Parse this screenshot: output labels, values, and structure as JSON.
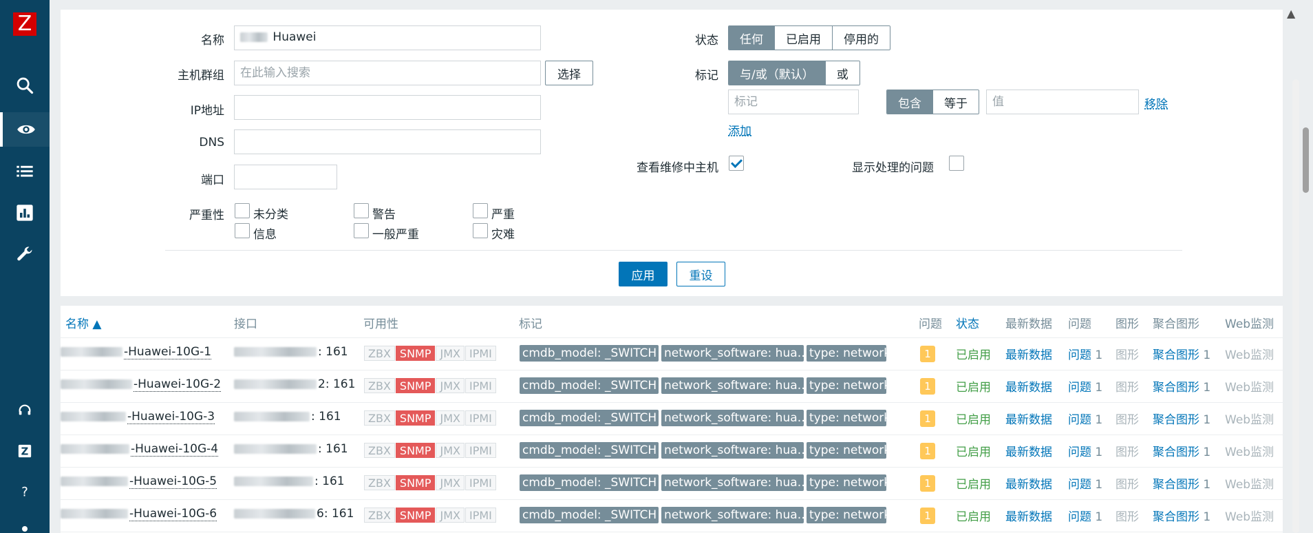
{
  "sidebar": {
    "logo": "Z",
    "icons": [
      "search-icon",
      "eye-icon",
      "list-icon",
      "chart-icon",
      "wrench-icon",
      "headset-icon",
      "zabbix-share-icon",
      "help-icon"
    ]
  },
  "filter": {
    "name_label": "名称",
    "name_value": "Huawei",
    "hostgroup_label": "主机群组",
    "hostgroup_placeholder": "在此输入搜索",
    "select_button": "选择",
    "ip_label": "IP地址",
    "dns_label": "DNS",
    "port_label": "端口",
    "severity_label": "严重性",
    "severities": [
      "未分类",
      "警告",
      "严重",
      "信息",
      "一般严重",
      "灾难"
    ],
    "status_label": "状态",
    "status_options": [
      "任何",
      "已启用",
      "停用的"
    ],
    "status_selected": "任何",
    "tags_label": "标记",
    "tag_mode_options": [
      "与/或（默认）",
      "或"
    ],
    "tag_placeholder": "标记",
    "tag_operator_options": [
      "包含",
      "等于"
    ],
    "value_placeholder": "值",
    "remove_link": "移除",
    "add_link": "添加",
    "maintenance_label": "查看维修中主机",
    "maintenance_checked": true,
    "suppressed_label": "显示处理的问题",
    "suppressed_checked": false,
    "apply_button": "应用",
    "reset_button": "重设"
  },
  "table": {
    "headers": {
      "name": "名称 ▲",
      "interface": "接口",
      "availability": "可用性",
      "tags": "标记",
      "problems": "问题",
      "status": "状态",
      "latest_data": "最新数据",
      "problems2": "问题",
      "graphs": "图形",
      "dashboards": "聚合图形",
      "web": "Web监测"
    },
    "rows": [
      {
        "name": "-Huawei-10G-1",
        "interface": ": 161",
        "problem_count": "1",
        "status": "已启用",
        "latest": "最新数据",
        "problems": "问题",
        "problems_n": "1",
        "graphs": "图形",
        "dashboards": "聚合图形",
        "dashboards_n": "1",
        "web": "Web监测"
      },
      {
        "name": "-Huawei-10G-2",
        "interface": "2: 161",
        "problem_count": "1",
        "status": "已启用",
        "latest": "最新数据",
        "problems": "问题",
        "problems_n": "1",
        "graphs": "图形",
        "dashboards": "聚合图形",
        "dashboards_n": "1",
        "web": "Web监测"
      },
      {
        "name": "-Huawei-10G-3",
        "interface": ": 161",
        "problem_count": "1",
        "status": "已启用",
        "latest": "最新数据",
        "problems": "问题",
        "problems_n": "1",
        "graphs": "图形",
        "dashboards": "聚合图形",
        "dashboards_n": "1",
        "web": "Web监测"
      },
      {
        "name": "-Huawei-10G-4",
        "interface": ": 161",
        "problem_count": "1",
        "status": "已启用",
        "latest": "最新数据",
        "problems": "问题",
        "problems_n": "1",
        "graphs": "图形",
        "dashboards": "聚合图形",
        "dashboards_n": "1",
        "web": "Web监测"
      },
      {
        "name": "-Huawei-10G-5",
        "interface": ": 161",
        "problem_count": "1",
        "status": "已启用",
        "latest": "最新数据",
        "problems": "问题",
        "problems_n": "1",
        "graphs": "图形",
        "dashboards": "聚合图形",
        "dashboards_n": "1",
        "web": "Web监测"
      },
      {
        "name": "-Huawei-10G-6",
        "interface": "6: 161",
        "problem_count": "1",
        "status": "已启用",
        "latest": "最新数据",
        "problems": "问题",
        "problems_n": "1",
        "graphs": "图形",
        "dashboards": "聚合图形",
        "dashboards_n": "1",
        "web": "Web监测"
      }
    ],
    "availability": [
      "ZBX",
      "SNMP",
      "JMX",
      "IPMI"
    ],
    "tags": [
      "cmdb_model: _SWITCH",
      "network_software: hua…",
      "type: network"
    ]
  },
  "colors": {
    "sidebar": "#0b4361",
    "primary": "#0275b8",
    "tag_bg": "#768d99",
    "snmp_error": "#e45959",
    "problem_badge": "#ffc859",
    "status_enabled": "#429e47"
  }
}
